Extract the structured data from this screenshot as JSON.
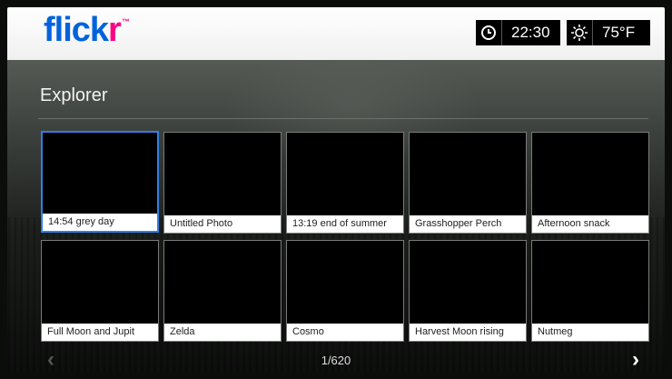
{
  "header": {
    "logo_main": "flick",
    "logo_accent": "r",
    "logo_mark": "™",
    "time": "22:30",
    "temperature": "75°F",
    "clock_icon": "clock-icon",
    "weather_icon": "sun-icon"
  },
  "section": {
    "title": "Explorer"
  },
  "photos": [
    {
      "caption": "14:54 grey day"
    },
    {
      "caption": "Untitled Photo"
    },
    {
      "caption": "13:19 end of summer"
    },
    {
      "caption": "Grasshopper Perch"
    },
    {
      "caption": "Afternoon snack"
    },
    {
      "caption": "Full Moon and Jupit"
    },
    {
      "caption": "Zelda"
    },
    {
      "caption": "Cosmo"
    },
    {
      "caption": "Harvest Moon rising"
    },
    {
      "caption": "Nutmeg"
    }
  ],
  "pagination": {
    "indicator": "1/620",
    "prev_glyph": "‹",
    "next_glyph": "›"
  },
  "colors": {
    "selection": "#2f7fe6",
    "flickr_blue": "#0063dc",
    "flickr_pink": "#ff0084"
  }
}
